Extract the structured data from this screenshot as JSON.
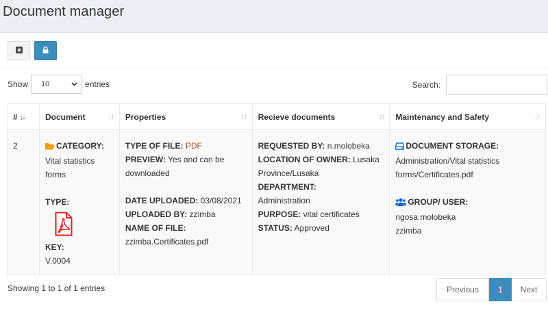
{
  "page": {
    "title": "Document manager"
  },
  "toolbar": {
    "buttons": [
      {
        "name": "clear-button",
        "icon": "close-square-icon"
      },
      {
        "name": "lock-button",
        "icon": "lock-icon"
      }
    ]
  },
  "controls": {
    "show_label": "Show",
    "entries_value": "10",
    "entries_label": "entries",
    "search_label": "Search:",
    "search_value": ""
  },
  "table": {
    "columns": [
      "#",
      "Document",
      "Properties",
      "Recieve documents",
      "Maintenancy and Safety"
    ],
    "rows": [
      {
        "index": "2",
        "document": {
          "category_label": "CATEGORY:",
          "category_value": "Vital statistics forms",
          "type_label": "TYPE:",
          "type_icon": "pdf-file-icon",
          "key_label": "KEY:",
          "key_value": "V.0004"
        },
        "properties": {
          "type_of_file_label": "TYPE OF FILE:",
          "type_of_file_value": "PDF",
          "preview_label": "PREVIEW:",
          "preview_value": "Yes and can be downloaded",
          "date_uploaded_label": "DATE UPLOADED:",
          "date_uploaded_value": "03/08/2021",
          "uploaded_by_label": "UPLOADED BY:",
          "uploaded_by_value": "zzimba",
          "name_of_file_label": "NAME OF FILE:",
          "name_of_file_value": "zzimba.Certificates.pdf"
        },
        "receive": {
          "requested_by_label": "REQUESTED BY:",
          "requested_by_value": "n.molobeka",
          "location_label": "LOCATION OF OWNER:",
          "location_value": "Lusaka Province/Lusaka",
          "department_label": "DEPARTMENT:",
          "department_value": "Administration",
          "purpose_label": "PURPOSE:",
          "purpose_value": "vital certificates",
          "status_label": "STATUS:",
          "status_value": "Approved"
        },
        "maintenance": {
          "storage_label": "DOCUMENT STORAGE:",
          "storage_icon": "hdd-icon",
          "storage_value": "Administration/Vital statistics forms/Certificates.pdf",
          "group_label": "GROUP/ USER:",
          "group_icon": "users-icon",
          "group_name": "ngosa molobeka",
          "group_user": "zzimba"
        }
      }
    ]
  },
  "footer": {
    "info": "Showing 1 to 1 of 1 entries",
    "prev_label": "Previous",
    "page_label": "1",
    "next_label": "Next"
  },
  "colors": {
    "primary": "#3c8dbc",
    "folder": "#f39c12",
    "pdf": "#e02020",
    "accent_text": "#a0522d",
    "icon_blue": "#1565c0"
  }
}
